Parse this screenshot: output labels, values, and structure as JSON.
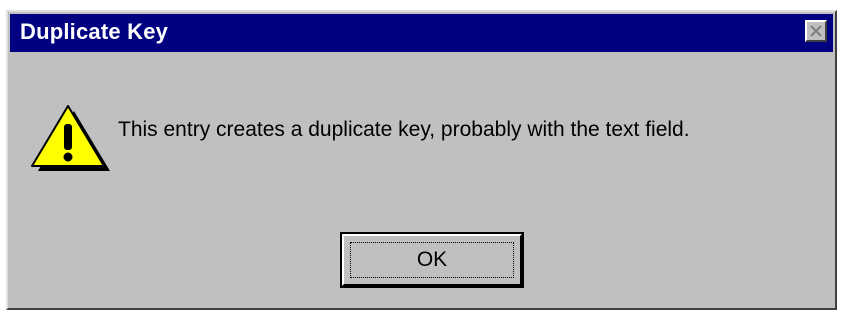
{
  "window": {
    "title": "Duplicate Key",
    "title_bar_color": "#000080",
    "background_color": "#c0c0c0",
    "close_icon": "close-x-icon"
  },
  "dialog": {
    "icon": "warning-icon",
    "message": "This entry creates a duplicate key, probably with the text field."
  },
  "buttons": {
    "ok_label": "OK"
  }
}
